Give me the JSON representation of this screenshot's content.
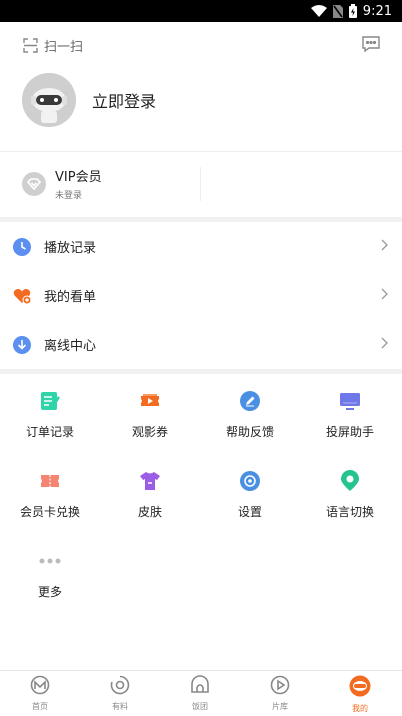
{
  "status": {
    "time": "9:21"
  },
  "header": {
    "scan_label": "扫一扫"
  },
  "profile": {
    "login_label": "立即登录"
  },
  "vip": {
    "title": "VIP会员",
    "subtitle": "未登录"
  },
  "menu": [
    {
      "label": "播放记录",
      "icon": "clock-icon",
      "color": "#5b8ff0"
    },
    {
      "label": "我的看单",
      "icon": "heart-plus-icon",
      "color": "#f36b21"
    },
    {
      "label": "离线中心",
      "icon": "download-icon",
      "color": "#5b8ff0"
    }
  ],
  "grid": [
    {
      "label": "订单记录",
      "icon": "order-icon",
      "color": "#2fd5a8"
    },
    {
      "label": "观影券",
      "icon": "ticket-icon",
      "color": "#f36b21"
    },
    {
      "label": "帮助反馈",
      "icon": "feedback-icon",
      "color": "#4a90e2"
    },
    {
      "label": "投屏助手",
      "icon": "screencast-icon",
      "color": "#6f78e8"
    },
    {
      "label": "会员卡兑换",
      "icon": "member-card-icon",
      "color": "#f48572"
    },
    {
      "label": "皮肤",
      "icon": "tshirt-icon",
      "color": "#9b5de5"
    },
    {
      "label": "设置",
      "icon": "settings-icon",
      "color": "#4a90e2"
    },
    {
      "label": "语言切换",
      "icon": "location-icon",
      "color": "#23c48e"
    },
    {
      "label": "更多",
      "icon": "more-icon",
      "color": "#bbbbbb"
    }
  ],
  "tabs": [
    {
      "label": "首页",
      "icon": "home-icon"
    },
    {
      "label": "有料",
      "icon": "discover-icon"
    },
    {
      "label": "饭团",
      "icon": "community-icon"
    },
    {
      "label": "片库",
      "icon": "library-icon"
    },
    {
      "label": "我的",
      "icon": "mine-icon",
      "active": true
    }
  ],
  "colors": {
    "accent": "#f36b21",
    "divider": "#eeeeee"
  }
}
